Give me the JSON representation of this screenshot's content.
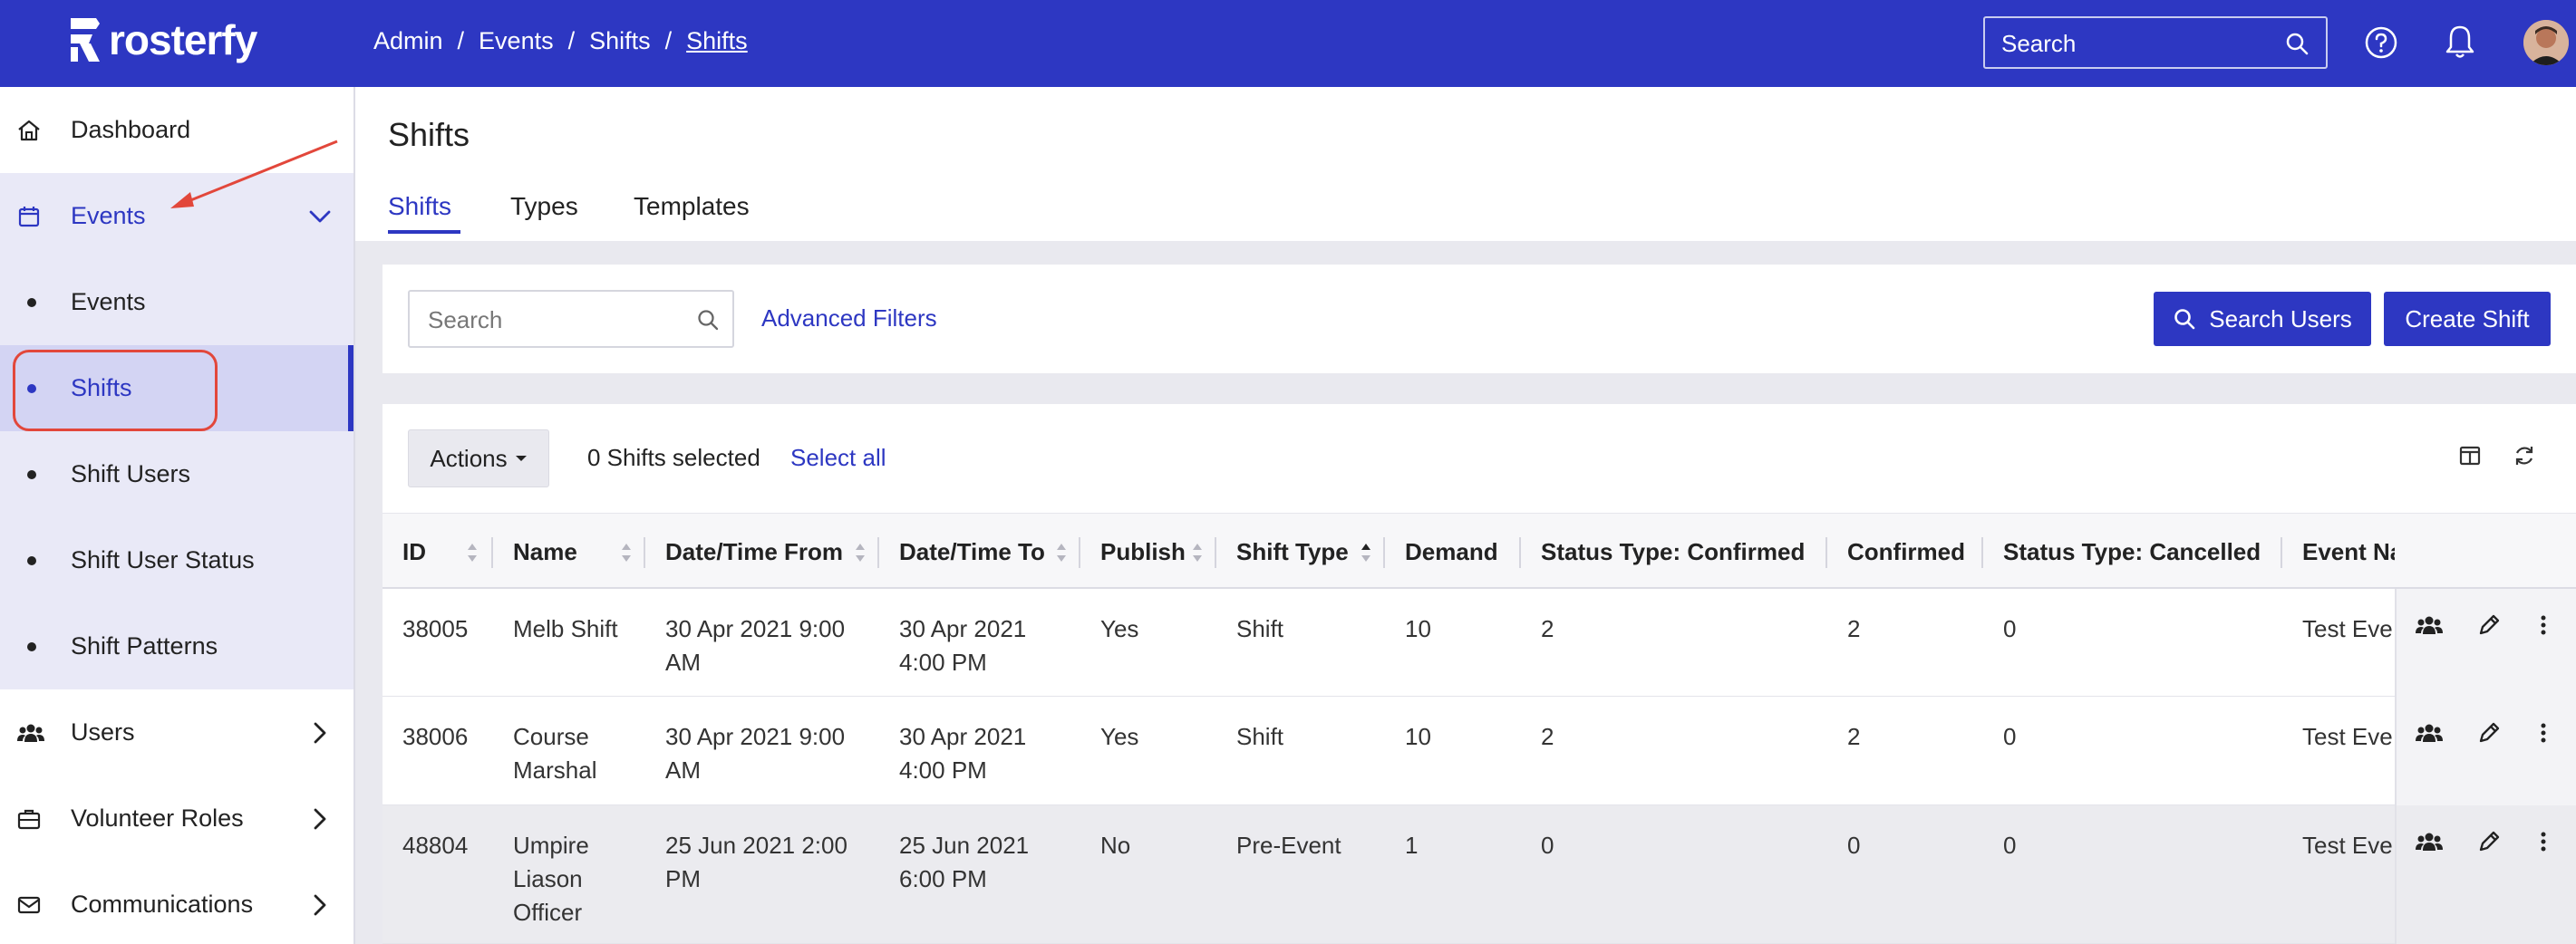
{
  "app": {
    "name": "rosterfy"
  },
  "breadcrumb": [
    "Admin",
    "Events",
    "Shifts",
    "Shifts"
  ],
  "topbar": {
    "search_placeholder": "Search"
  },
  "sidebar": {
    "items": [
      {
        "label": "Dashboard",
        "icon": "home-icon"
      },
      {
        "label": "Events",
        "icon": "calendar-icon",
        "expanded": true
      },
      {
        "label": "Events",
        "sub": true
      },
      {
        "label": "Shifts",
        "sub": true,
        "active": true
      },
      {
        "label": "Shift Users",
        "sub": true
      },
      {
        "label": "Shift User Status",
        "sub": true
      },
      {
        "label": "Shift Patterns",
        "sub": true
      },
      {
        "label": "Users",
        "icon": "users-icon"
      },
      {
        "label": "Volunteer Roles",
        "icon": "briefcase-icon"
      },
      {
        "label": "Communications",
        "icon": "mail-icon"
      }
    ]
  },
  "page": {
    "title": "Shifts",
    "tabs": [
      {
        "label": "Shifts",
        "active": true
      },
      {
        "label": "Types"
      },
      {
        "label": "Templates"
      }
    ]
  },
  "filters": {
    "search_placeholder": "Search",
    "advanced_filters": "Advanced Filters",
    "search_users_button": "Search Users",
    "create_shift_button": "Create Shift"
  },
  "table_toolbar": {
    "actions": "Actions",
    "selected_count": "0 Shifts selected",
    "select_all": "Select all"
  },
  "table": {
    "columns": [
      "ID",
      "Name",
      "Date/Time From",
      "Date/Time To",
      "Publish",
      "Shift Type",
      "Demand",
      "Status Type: Confirmed",
      "Confirmed",
      "Status Type: Cancelled",
      "Event Na"
    ],
    "rows": [
      {
        "id": "38005",
        "name": "Melb Shift",
        "from": "30 Apr 2021 9:00 AM",
        "to": "30 Apr 2021 4:00 PM",
        "publish": "Yes",
        "type": "Shift",
        "demand": "10",
        "st_confirmed": "2",
        "confirmed": "2",
        "st_cancelled": "0",
        "event": "Test Eve"
      },
      {
        "id": "38006",
        "name": "Course Marshal",
        "from": "30 Apr 2021 9:00 AM",
        "to": "30 Apr 2021 4:00 PM",
        "publish": "Yes",
        "type": "Shift",
        "demand": "10",
        "st_confirmed": "2",
        "confirmed": "2",
        "st_cancelled": "0",
        "event": "Test Eve"
      },
      {
        "id": "48804",
        "name": "Umpire Liason Officer",
        "from": "25 Jun 2021 2:00 PM",
        "to": "25 Jun 2021 6:00 PM",
        "publish": "No",
        "type": "Pre-Event",
        "demand": "1",
        "st_confirmed": "0",
        "confirmed": "0",
        "st_cancelled": "0",
        "event": "Test Eve"
      }
    ]
  },
  "colors": {
    "brand": "#2d37c2",
    "annotation": "#e2473b"
  }
}
